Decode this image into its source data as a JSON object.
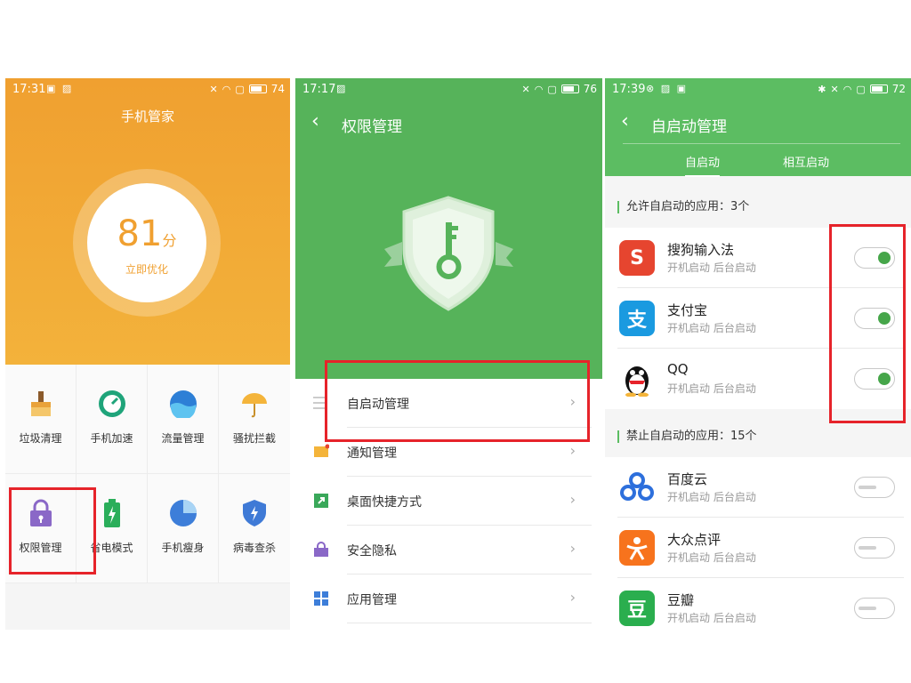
{
  "colors": {
    "orange": "#f0a030",
    "green_header": "#56b35a",
    "toggle_on": "#46a64a",
    "highlight": "#e6232a"
  },
  "panel1": {
    "status": {
      "time": "17:31",
      "battery": "74"
    },
    "title": "手机管家",
    "score": "81",
    "score_unit": "分",
    "optimize": "立即优化",
    "tiles": [
      {
        "label": "垃圾清理",
        "icon": "broom-icon"
      },
      {
        "label": "手机加速",
        "icon": "speedometer-icon"
      },
      {
        "label": "流量管理",
        "icon": "data-icon"
      },
      {
        "label": "骚扰拦截",
        "icon": "umbrella-icon"
      },
      {
        "label": "权限管理",
        "icon": "lock-icon"
      },
      {
        "label": "省电模式",
        "icon": "battery-icon"
      },
      {
        "label": "手机瘦身",
        "icon": "pie-icon"
      },
      {
        "label": "病毒查杀",
        "icon": "shield-icon"
      }
    ]
  },
  "panel2": {
    "status": {
      "time": "17:17",
      "battery": "76"
    },
    "title": "权限管理",
    "items": [
      {
        "label": "自启动管理",
        "icon": "menu-icon"
      },
      {
        "label": "通知管理",
        "icon": "notification-icon"
      },
      {
        "label": "桌面快捷方式",
        "icon": "shortcut-icon"
      },
      {
        "label": "安全隐私",
        "icon": "privacy-icon"
      },
      {
        "label": "应用管理",
        "icon": "apps-icon"
      }
    ]
  },
  "panel3": {
    "status": {
      "time": "17:39",
      "battery": "72"
    },
    "title": "自启动管理",
    "tabs": [
      "自启动",
      "相互启动"
    ],
    "allowed_header": "允许自启动的应用：3个",
    "blocked_header": "禁止自启动的应用：15个",
    "sub_label": "开机启动  后台启动",
    "allowed": [
      {
        "name": "搜狗输入法",
        "icon_text": "S",
        "color": "#e6452f",
        "enabled": true
      },
      {
        "name": "支付宝",
        "icon_text": "支",
        "color": "#1a9ae0",
        "enabled": true
      },
      {
        "name": "QQ",
        "icon_text": "",
        "color": "#ffffff",
        "enabled": true
      }
    ],
    "blocked": [
      {
        "name": "百度云",
        "icon_text": "",
        "color": "#ffffff",
        "enabled": false
      },
      {
        "name": "大众点评",
        "icon_text": "",
        "color": "#f7731d",
        "enabled": false
      },
      {
        "name": "豆瓣",
        "icon_text": "豆",
        "color": "#2aae4e",
        "enabled": false
      }
    ]
  }
}
